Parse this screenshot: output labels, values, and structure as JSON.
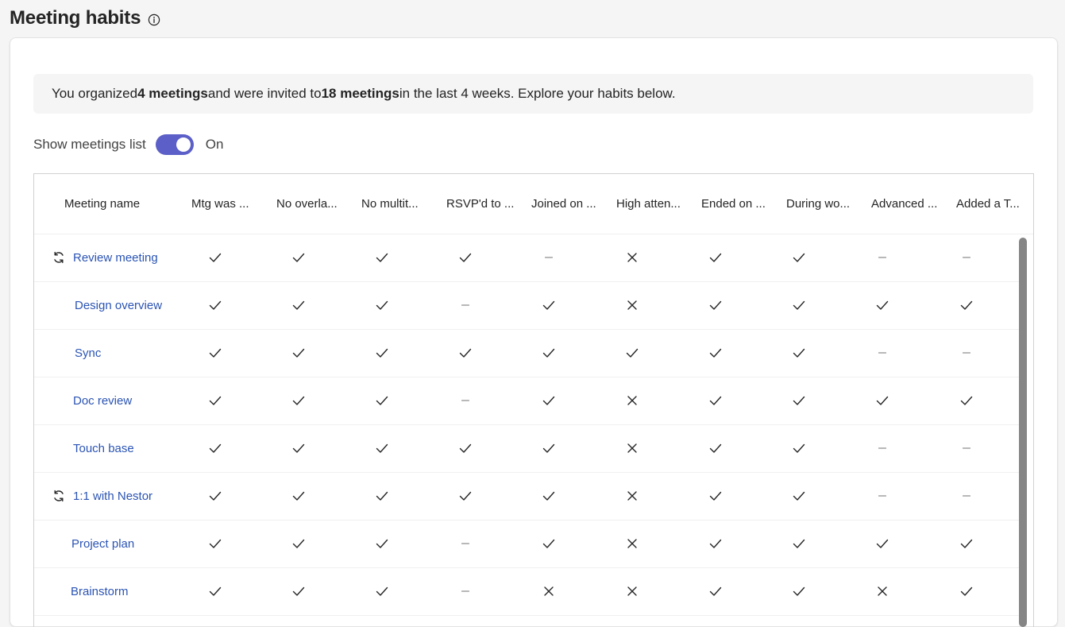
{
  "page": {
    "title": "Meeting habits",
    "info_icon": "info-icon"
  },
  "summary": {
    "part1": "You organized ",
    "organized": "4 meetings",
    "part2": " and were invited to ",
    "invited": "18 meetings",
    "part3": " in the last 4 weeks. Explore your habits below."
  },
  "toggle": {
    "label": "Show meetings list",
    "state": "On",
    "on": true,
    "color": "#5b5fc7"
  },
  "table": {
    "name_header": "Meeting name",
    "columns": [
      "Mtg was ...",
      "No overla...",
      "No multit...",
      "RSVP'd to ...",
      "Joined on ...",
      "High atten...",
      "Ended on ...",
      "During wo...",
      "Advanced ...",
      "Added a T..."
    ],
    "link_color": "#2b54b4",
    "rows": [
      {
        "name": "Review meeting",
        "recurring": true,
        "values": [
          "check",
          "check",
          "check",
          "check",
          "dash",
          "cross",
          "check",
          "check",
          "dash",
          "dash"
        ]
      },
      {
        "name": "Design overview",
        "recurring": false,
        "values": [
          "check",
          "check",
          "check",
          "dash",
          "check",
          "cross",
          "check",
          "check",
          "check",
          "check"
        ]
      },
      {
        "name": "Sync",
        "recurring": false,
        "values": [
          "check",
          "check",
          "check",
          "check",
          "check",
          "check",
          "check",
          "check",
          "dash",
          "dash"
        ]
      },
      {
        "name": "Doc review",
        "recurring": false,
        "values": [
          "check",
          "check",
          "check",
          "dash",
          "check",
          "cross",
          "check",
          "check",
          "check",
          "check"
        ]
      },
      {
        "name": "Touch base",
        "recurring": false,
        "values": [
          "check",
          "check",
          "check",
          "check",
          "check",
          "cross",
          "check",
          "check",
          "dash",
          "dash"
        ]
      },
      {
        "name": "1:1 with Nestor",
        "recurring": true,
        "values": [
          "check",
          "check",
          "check",
          "check",
          "check",
          "cross",
          "check",
          "check",
          "dash",
          "dash"
        ]
      },
      {
        "name": "Project plan",
        "recurring": false,
        "values": [
          "check",
          "check",
          "check",
          "dash",
          "check",
          "cross",
          "check",
          "check",
          "check",
          "check"
        ]
      },
      {
        "name": "Brainstorm",
        "recurring": false,
        "values": [
          "check",
          "check",
          "check",
          "dash",
          "cross",
          "cross",
          "check",
          "check",
          "cross",
          "check"
        ]
      }
    ]
  }
}
